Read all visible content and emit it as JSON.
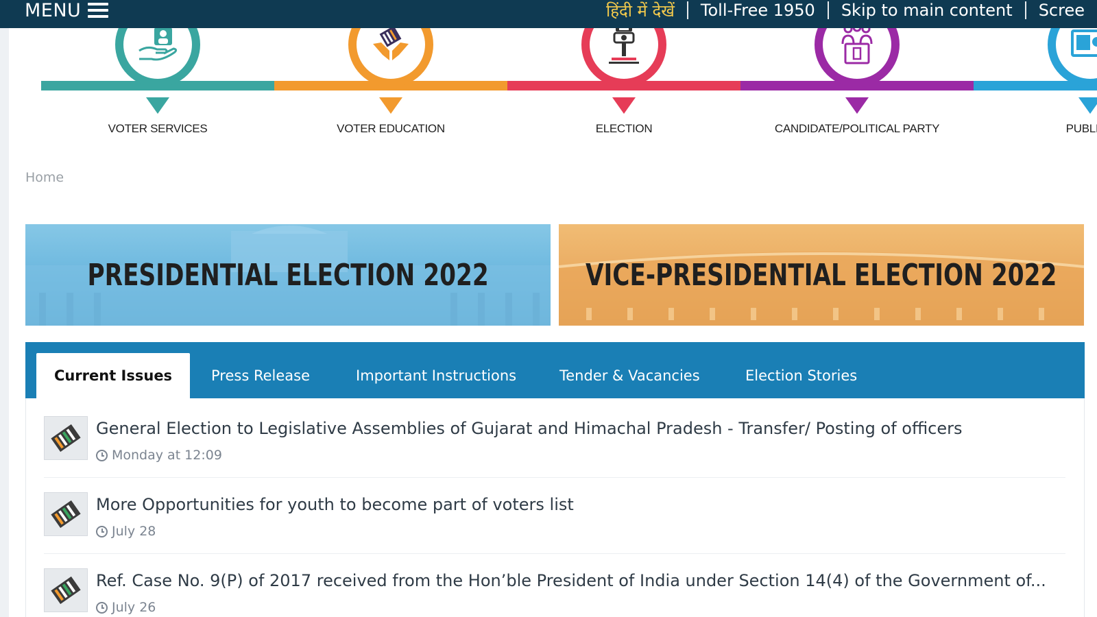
{
  "topbar": {
    "menu_label": "MENU",
    "links": [
      {
        "label": "हिंदी में देखें"
      },
      {
        "label": "Toll-Free 1950"
      },
      {
        "label": "Skip to main content"
      },
      {
        "label": "Scree"
      }
    ]
  },
  "categories": [
    {
      "label": "VOTER SERVICES",
      "icon": "voter-services-icon",
      "color": "#3aa6a0"
    },
    {
      "label": "VOTER EDUCATION",
      "icon": "voter-education-icon",
      "color": "#f29a2e"
    },
    {
      "label": "ELECTION",
      "icon": "election-icon",
      "color": "#e63c57"
    },
    {
      "label": "CANDIDATE/POLITICAL PARTY",
      "icon": "candidate-party-icon",
      "color": "#9b2aa5"
    },
    {
      "label": "PUBLICA",
      "icon": "publication-icon",
      "color": "#2aa3d8"
    }
  ],
  "breadcrumb": {
    "home": "Home"
  },
  "banners": {
    "presidential": "PRESIDENTIAL ELECTION 2022",
    "vice_presidential": "VICE-PRESIDENTIAL ELECTION 2022"
  },
  "tabs": [
    {
      "label": "Current Issues",
      "active": true
    },
    {
      "label": "Press Release",
      "active": false
    },
    {
      "label": "Important Instructions",
      "active": false
    },
    {
      "label": "Tender & Vacancies",
      "active": false
    },
    {
      "label": "Election Stories",
      "active": false
    }
  ],
  "news": [
    {
      "title": "General Election to Legislative Assemblies of Gujarat and Himachal Pradesh - Transfer/ Posting of officers",
      "date": "Monday at 12:09"
    },
    {
      "title": "More Opportunities for youth to become part of voters list",
      "date": "July 28"
    },
    {
      "title": "Ref. Case No. 9(P) of 2017 received from the Hon’ble President of India under Section 14(4) of the Government of...",
      "date": "July 26"
    }
  ],
  "colors": {
    "topbar": "#0f3a52",
    "tabbar": "#1a7fb5",
    "hindi_link": "#f2c94c"
  }
}
